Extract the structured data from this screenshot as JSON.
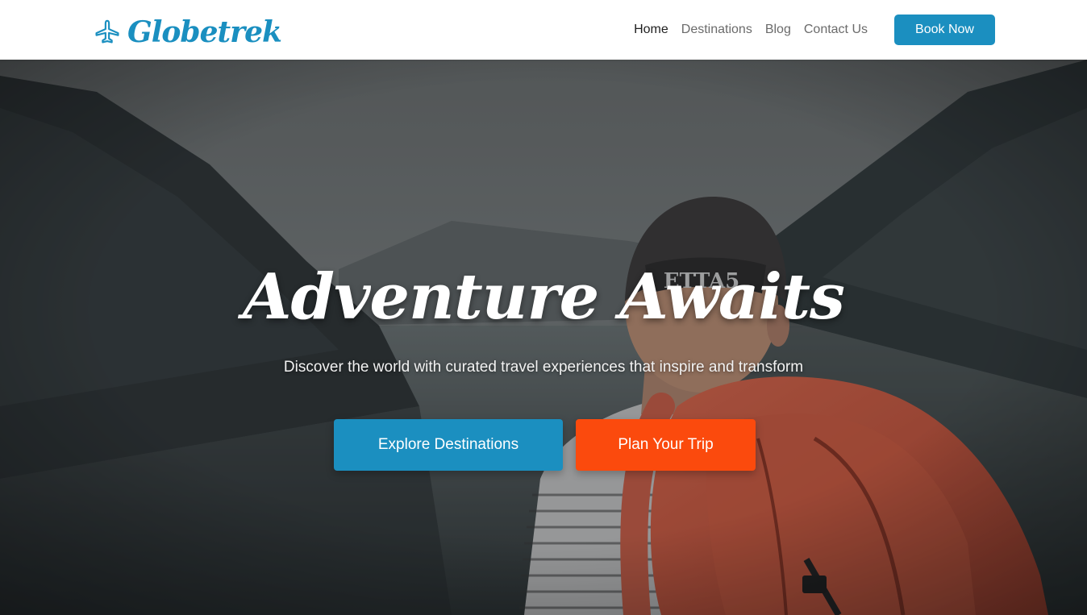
{
  "colors": {
    "brand": "#1a8fc0",
    "primary_button": "#1b8fc0",
    "secondary_button": "#fb4a0d",
    "nav_text": "#6b6b6b",
    "nav_active": "#1f1f1f"
  },
  "brand": {
    "name": "Globetrek",
    "icon": "airplane-icon"
  },
  "nav": {
    "links": [
      {
        "label": "Home",
        "active": true
      },
      {
        "label": "Destinations",
        "active": false
      },
      {
        "label": "Blog",
        "active": false
      },
      {
        "label": "Contact Us",
        "active": false
      }
    ],
    "cta_label": "Book Now"
  },
  "hero": {
    "title": "Adventure Awaits",
    "subtitle": "Discover the world with curated travel experiences that inspire and transform",
    "buttons": {
      "explore_label": "Explore Destinations",
      "plan_label": "Plan Your Trip"
    }
  }
}
